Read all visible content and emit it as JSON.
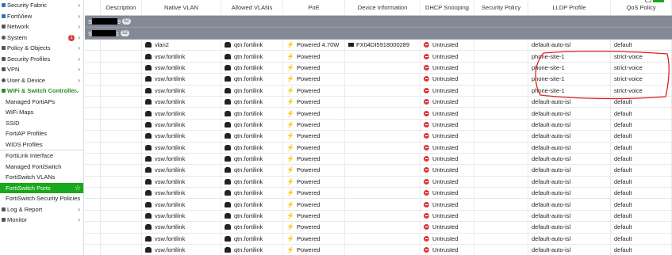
{
  "sidebar": {
    "items": [
      {
        "label": "Security Fabric",
        "icon": "fabric-icon",
        "chevron": true
      },
      {
        "label": "FortiView",
        "icon": "chart-icon",
        "chevron": true
      },
      {
        "label": "Network",
        "icon": "network-icon",
        "chevron": true
      },
      {
        "label": "System",
        "icon": "gear-icon",
        "chevron": true,
        "badge": "1"
      },
      {
        "label": "Policy & Objects",
        "icon": "policy-icon",
        "chevron": true
      },
      {
        "label": "Security Profiles",
        "icon": "lock-icon",
        "chevron": true
      },
      {
        "label": "VPN",
        "icon": "vpn-icon",
        "chevron": true
      },
      {
        "label": "User & Device",
        "icon": "user-icon",
        "chevron": true
      },
      {
        "label": "WiFi & Switch Controller",
        "icon": "wifi-icon",
        "chevron": true,
        "expanded": true
      }
    ],
    "wifi_sub_a": [
      "Managed FortiAPs",
      "WiFi Maps",
      "SSID",
      "FortiAP Profiles",
      "WIDS Profiles"
    ],
    "wifi_sub_b": [
      "FortiLink Interface",
      "Managed FortiSwitch",
      "FortiSwitch VLANs",
      "FortiSwitch Ports",
      "FortiSwitch Security Policies"
    ],
    "active": "FortiSwitch Ports",
    "bottom": [
      {
        "label": "Log & Report",
        "icon": "log-icon"
      },
      {
        "label": "Monitor",
        "icon": "monitor-icon"
      }
    ]
  },
  "table": {
    "headers": [
      "",
      "Description",
      "Native VLAN",
      "Allowed VLANs",
      "PoE",
      "Device Information",
      "DHCP Snooping",
      "Security Policy",
      "LLDP Profile",
      "QoS Policy"
    ],
    "groups": [
      {
        "prefix": "S",
        "suffix": "9",
        "count": "52"
      },
      {
        "prefix": "S",
        "suffix": "1",
        "count": "52"
      }
    ],
    "rows": [
      {
        "native_vlan": "vlan2",
        "allowed": "qtn.fortilink",
        "poe": "Powered 4.70W",
        "device": "FX04DI5918000289",
        "dhcp": "Untrusted",
        "lldp": "default-auto-isl",
        "qos": "default"
      },
      {
        "native_vlan": "vsw.fortilink",
        "allowed": "qtn.fortilink",
        "poe": "Powered",
        "device": "",
        "dhcp": "Untrusted",
        "lldp": "phone-site-1",
        "qos": "strict-voice"
      },
      {
        "native_vlan": "vsw.fortilink",
        "allowed": "qtn.fortilink",
        "poe": "Powered",
        "device": "",
        "dhcp": "Untrusted",
        "lldp": "phone-site-1",
        "qos": "strict-voice"
      },
      {
        "native_vlan": "vsw.fortilink",
        "allowed": "qtn.fortilink",
        "poe": "Powered",
        "device": "",
        "dhcp": "Untrusted",
        "lldp": "phone-site-1",
        "qos": "strict-voice"
      },
      {
        "native_vlan": "vsw.fortilink",
        "allowed": "qtn.fortilink",
        "poe": "Powered",
        "device": "",
        "dhcp": "Untrusted",
        "lldp": "phone-site-1",
        "qos": "strict-voice"
      },
      {
        "native_vlan": "vsw.fortilink",
        "allowed": "qtn.fortilink",
        "poe": "Powered",
        "device": "",
        "dhcp": "Untrusted",
        "lldp": "default-auto-isl",
        "qos": "default"
      },
      {
        "native_vlan": "vsw.fortilink",
        "allowed": "qtn.fortilink",
        "poe": "Powered",
        "device": "",
        "dhcp": "Untrusted",
        "lldp": "default-auto-isl",
        "qos": "default"
      },
      {
        "native_vlan": "vsw.fortilink",
        "allowed": "qtn.fortilink",
        "poe": "Powered",
        "device": "",
        "dhcp": "Untrusted",
        "lldp": "default-auto-isl",
        "qos": "default"
      },
      {
        "native_vlan": "vsw.fortilink",
        "allowed": "qtn.fortilink",
        "poe": "Powered",
        "device": "",
        "dhcp": "Untrusted",
        "lldp": "default-auto-isl",
        "qos": "default"
      },
      {
        "native_vlan": "vsw.fortilink",
        "allowed": "qtn.fortilink",
        "poe": "Powered",
        "device": "",
        "dhcp": "Untrusted",
        "lldp": "default-auto-isl",
        "qos": "default"
      },
      {
        "native_vlan": "vsw.fortilink",
        "allowed": "qtn.fortilink",
        "poe": "Powered",
        "device": "",
        "dhcp": "Untrusted",
        "lldp": "default-auto-isl",
        "qos": "default"
      },
      {
        "native_vlan": "vsw.fortilink",
        "allowed": "qtn.fortilink",
        "poe": "Powered",
        "device": "",
        "dhcp": "Untrusted",
        "lldp": "default-auto-isl",
        "qos": "default"
      },
      {
        "native_vlan": "vsw.fortilink",
        "allowed": "qtn.fortilink",
        "poe": "Powered",
        "device": "",
        "dhcp": "Untrusted",
        "lldp": "default-auto-isl",
        "qos": "default"
      },
      {
        "native_vlan": "vsw.fortilink",
        "allowed": "qtn.fortilink",
        "poe": "Powered",
        "device": "",
        "dhcp": "Untrusted",
        "lldp": "default-auto-isl",
        "qos": "default"
      },
      {
        "native_vlan": "vsw.fortilink",
        "allowed": "qtn.fortilink",
        "poe": "Powered",
        "device": "",
        "dhcp": "Untrusted",
        "lldp": "default-auto-isl",
        "qos": "default"
      },
      {
        "native_vlan": "vsw.fortilink",
        "allowed": "qtn.fortilink",
        "poe": "Powered",
        "device": "",
        "dhcp": "Untrusted",
        "lldp": "default-auto-isl",
        "qos": "default"
      },
      {
        "native_vlan": "vsw.fortilink",
        "allowed": "qtn.fortilink",
        "poe": "Powered",
        "device": "",
        "dhcp": "Untrusted",
        "lldp": "default-auto-isl",
        "qos": "default"
      },
      {
        "native_vlan": "vsw.fortilink",
        "allowed": "qtn.fortilink",
        "poe": "Powered",
        "device": "",
        "dhcp": "Untrusted",
        "lldp": "default-auto-isl",
        "qos": "default"
      },
      {
        "native_vlan": "vsw.fortilink",
        "allowed": "qtn.fortilink",
        "poe": "Powered",
        "device": "",
        "dhcp": "Untrusted",
        "lldp": "default-auto-isl",
        "qos": "default"
      },
      {
        "native_vlan": "vsw.fortilink",
        "allowed": "qtn.fortilink",
        "poe": "Powered",
        "device": "",
        "dhcp": "Untrusted",
        "lldp": "default-auto-isl",
        "qos": "default"
      }
    ]
  },
  "colors": {
    "accent": "#18a81c",
    "group_row": "#838a96",
    "danger": "#d9393b",
    "annotation": "#e02020"
  }
}
